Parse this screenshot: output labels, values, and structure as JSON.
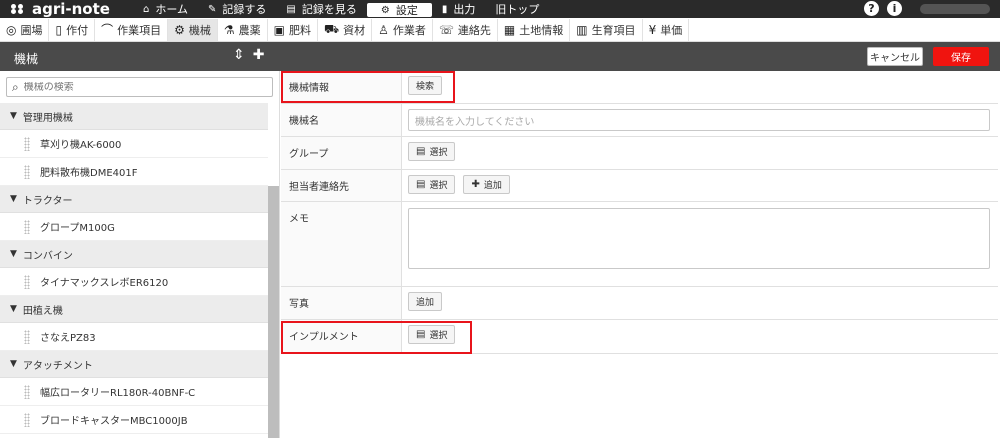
{
  "app": {
    "logo_text": "agri-note"
  },
  "topnav": [
    {
      "icon": "house-icon",
      "glyph": "⌂",
      "label": "ホーム"
    },
    {
      "icon": "pencil-icon",
      "glyph": "✎",
      "label": "記録する"
    },
    {
      "icon": "document-icon",
      "glyph": "▤",
      "label": "記録を見る"
    },
    {
      "icon": "gear-icon",
      "glyph": "⚙",
      "label": "設定",
      "active": true
    },
    {
      "icon": "file-icon",
      "glyph": "▮",
      "label": "出力"
    },
    {
      "icon": "",
      "glyph": "",
      "label": "旧トップ"
    }
  ],
  "topright": {
    "help": "?",
    "info": "i"
  },
  "subnav": [
    {
      "icon": "map-pin-icon",
      "glyph": "◎",
      "label": "圃場"
    },
    {
      "icon": "crop-icon",
      "glyph": "▯",
      "label": "作付"
    },
    {
      "icon": "sickle-icon",
      "glyph": "⌒",
      "label": "作業項目"
    },
    {
      "icon": "machine-icon",
      "glyph": "⚙",
      "label": "機械",
      "active": true
    },
    {
      "icon": "flask-icon",
      "glyph": "⚗",
      "label": "農薬"
    },
    {
      "icon": "npk-icon",
      "glyph": "▣",
      "label": "肥料"
    },
    {
      "icon": "wheelbarrow-icon",
      "glyph": "⛟",
      "label": "資材"
    },
    {
      "icon": "worker-icon",
      "glyph": "♙",
      "label": "作業者"
    },
    {
      "icon": "contact-icon",
      "glyph": "☏",
      "label": "連絡先"
    },
    {
      "icon": "land-icon",
      "glyph": "▦",
      "label": "土地情報"
    },
    {
      "icon": "growth-icon",
      "glyph": "▥",
      "label": "生育項目"
    },
    {
      "icon": "yen-icon",
      "glyph": "¥",
      "label": "単価"
    }
  ],
  "header": {
    "title": "機械",
    "cancel_label": "キャンセル",
    "save_label": "保存"
  },
  "sidebar": {
    "search_placeholder": "機械の検索",
    "groups": [
      {
        "label": "管理用機械",
        "items": [
          "草刈り機AK-6000",
          "肥料散布機DME401F"
        ]
      },
      {
        "label": "トラクター",
        "items": [
          "グロープM100G"
        ]
      },
      {
        "label": "コンバイン",
        "items": [
          "タイナマックスレボER6120"
        ]
      },
      {
        "label": "田植え機",
        "items": [
          "さなえPZ83"
        ]
      },
      {
        "label": "アタッチメント",
        "items": [
          "幅広ロータリーRL180R-40BNF-C",
          "ブロードキャスターMBC1000JB"
        ]
      }
    ]
  },
  "form": {
    "machine_info": {
      "label": "機械情報",
      "button": "検索"
    },
    "machine_name": {
      "label": "機械名",
      "placeholder": "機械名を入力してください"
    },
    "group": {
      "label": "グループ",
      "button": "選択"
    },
    "contact": {
      "label": "担当者連絡先",
      "select_button": "選択",
      "add_button": "追加"
    },
    "memo": {
      "label": "メモ"
    },
    "photo": {
      "label": "写真",
      "button": "追加"
    },
    "implement": {
      "label": "インプルメント",
      "button": "選択"
    }
  },
  "colors": {
    "highlight": "#e8141b",
    "save": "#f0140f",
    "header": "#4a4a4a",
    "topbar": "#2a2a2a"
  }
}
